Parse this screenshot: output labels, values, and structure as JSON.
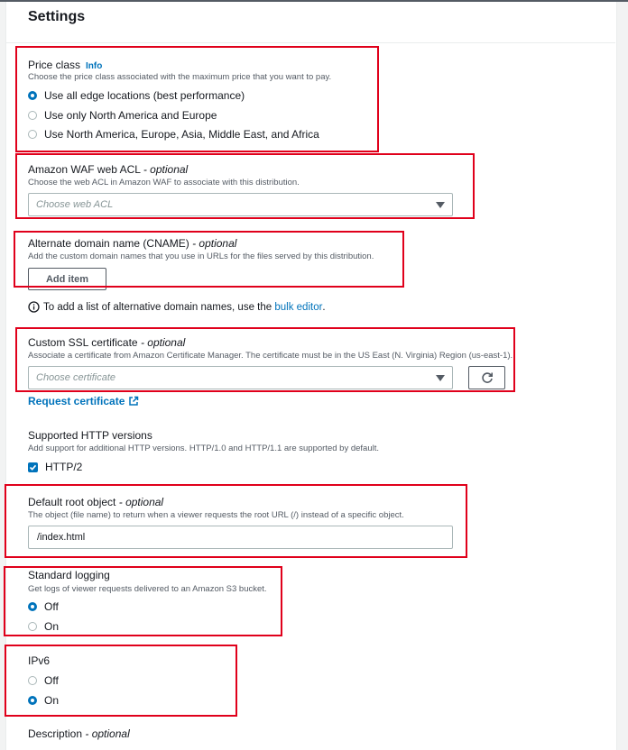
{
  "section": {
    "title": "Settings"
  },
  "price_class": {
    "label": "Price class",
    "info": "Info",
    "description": "Choose the price class associated with the maximum price that you want to pay.",
    "options": [
      {
        "label": "Use all edge locations (best performance)",
        "selected": true
      },
      {
        "label": "Use only North America and Europe",
        "selected": false
      },
      {
        "label": "Use North America, Europe, Asia, Middle East, and Africa",
        "selected": false
      }
    ]
  },
  "waf": {
    "label": "Amazon WAF web ACL",
    "optional": "- optional",
    "description": "Choose the web ACL in Amazon WAF to associate with this distribution.",
    "placeholder": "Choose web ACL"
  },
  "cname": {
    "label": "Alternate domain name (CNAME)",
    "optional": "- optional",
    "description": "Add the custom domain names that you use in URLs for the files served by this distribution.",
    "add_item": "Add item",
    "bulk_text": "To add a list of alternative domain names, use the",
    "bulk_link": "bulk editor",
    "bulk_suffix": "."
  },
  "ssl": {
    "label": "Custom SSL certificate",
    "optional": "- optional",
    "description": "Associate a certificate from Amazon Certificate Manager. The certificate must be in the US East (N. Virginia) Region (us-east-1).",
    "placeholder": "Choose certificate",
    "request_link": "Request certificate"
  },
  "http_versions": {
    "label": "Supported HTTP versions",
    "description": "Add support for additional HTTP versions. HTTP/1.0 and HTTP/1.1 are supported by default.",
    "checkbox_label": "HTTP/2",
    "checked": true
  },
  "root_object": {
    "label": "Default root object",
    "optional": "- optional",
    "description": "The object (file name) to return when a viewer requests the root URL (/) instead of a specific object.",
    "value": "/index.html"
  },
  "logging": {
    "label": "Standard logging",
    "description": "Get logs of viewer requests delivered to an Amazon S3 bucket.",
    "options": [
      {
        "label": "Off",
        "selected": true
      },
      {
        "label": "On",
        "selected": false
      }
    ]
  },
  "ipv6": {
    "label": "IPv6",
    "options": [
      {
        "label": "Off",
        "selected": false
      },
      {
        "label": "On",
        "selected": true
      }
    ]
  },
  "description_field": {
    "label": "Description",
    "optional": "- optional"
  },
  "colors": {
    "accent": "#0073bb",
    "highlight": "#e0001b"
  }
}
